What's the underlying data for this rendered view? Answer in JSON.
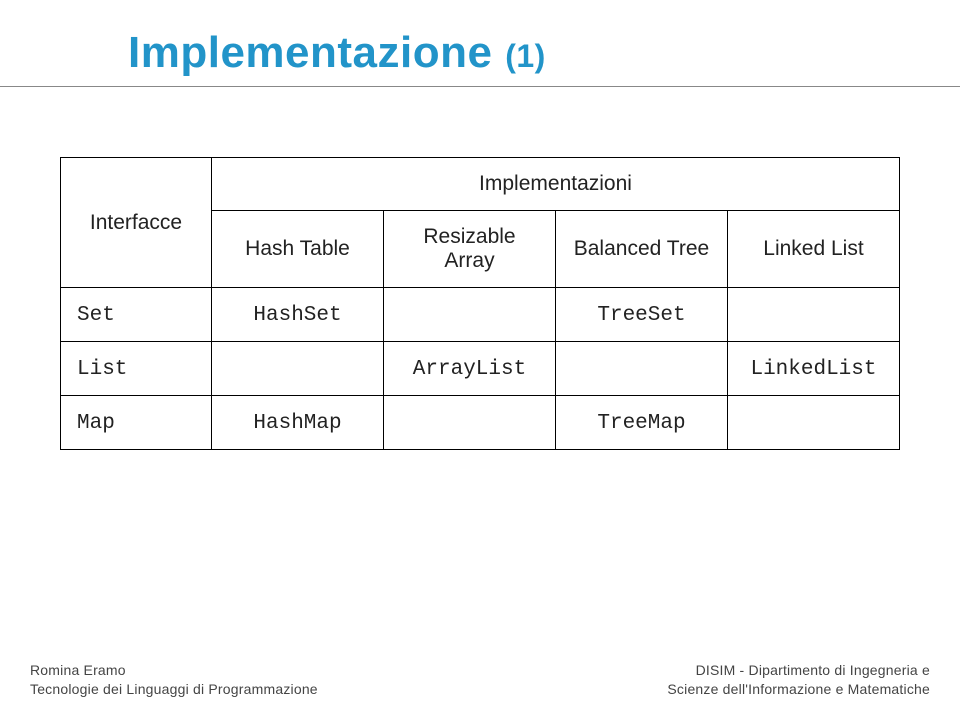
{
  "title_main": "Implementazione",
  "title_suffix": "(1)",
  "table": {
    "header_rowspan": "Interfacce",
    "header_colspan": "Implementazioni",
    "subheaders": [
      "Hash Table",
      "Resizable Array",
      "Balanced Tree",
      "Linked List"
    ],
    "rows": [
      {
        "iface": "Set",
        "c0": "HashSet",
        "c1": "",
        "c2": "TreeSet",
        "c3": ""
      },
      {
        "iface": "List",
        "c0": "",
        "c1": "ArrayList",
        "c2": "",
        "c3": "LinkedList"
      },
      {
        "iface": "Map",
        "c0": "HashMap",
        "c1": "",
        "c2": "TreeMap",
        "c3": ""
      }
    ]
  },
  "footer": {
    "left_line1": "Romina Eramo",
    "left_line2": "Tecnologie dei Linguaggi di Programmazione",
    "right_line1": "DISIM - Dipartimento di Ingegneria e",
    "right_line2": "Scienze dell'Informazione e Matematiche"
  },
  "chart_data": {
    "type": "table",
    "title": "Implementazione (1)",
    "row_header": "Interfacce",
    "column_group_header": "Implementazioni",
    "columns": [
      "Hash Table",
      "Resizable Array",
      "Balanced Tree",
      "Linked List"
    ],
    "rows": [
      {
        "Interfacce": "Set",
        "Hash Table": "HashSet",
        "Resizable Array": "",
        "Balanced Tree": "TreeSet",
        "Linked List": ""
      },
      {
        "Interfacce": "List",
        "Hash Table": "",
        "Resizable Array": "ArrayList",
        "Balanced Tree": "",
        "Linked List": "LinkedList"
      },
      {
        "Interfacce": "Map",
        "Hash Table": "HashMap",
        "Resizable Array": "",
        "Balanced Tree": "TreeMap",
        "Linked List": ""
      }
    ]
  }
}
